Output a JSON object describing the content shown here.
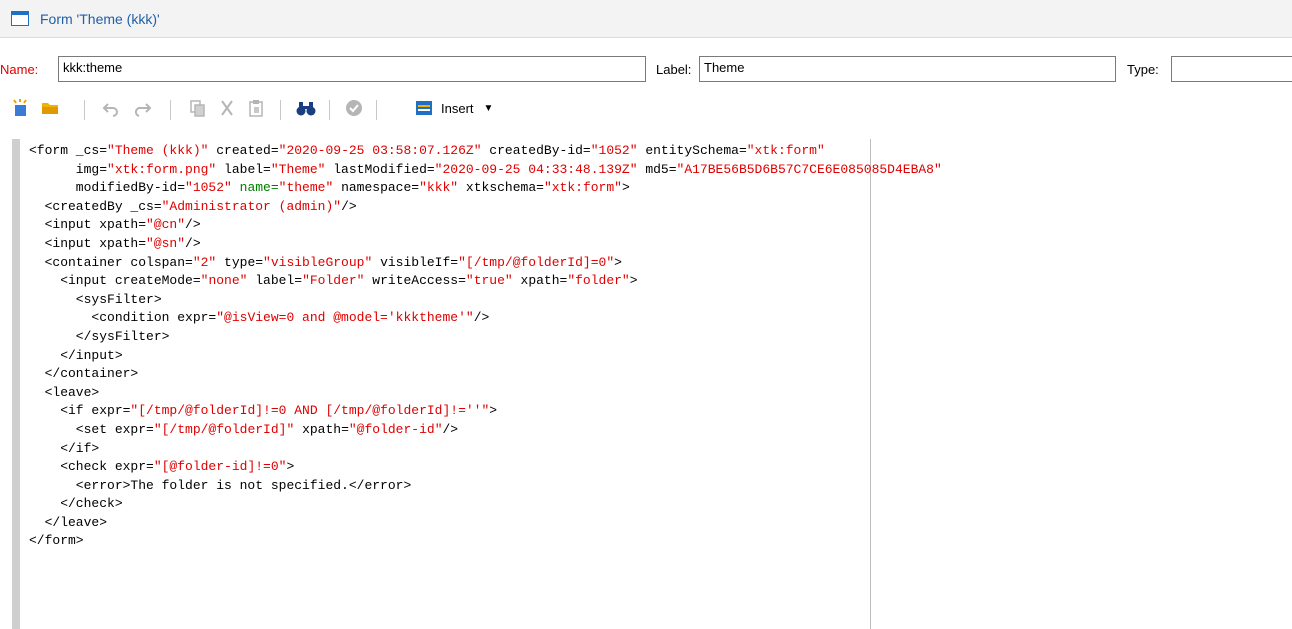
{
  "window": {
    "title": "Form 'Theme (kkk)'"
  },
  "fields": {
    "name_label": "Name:",
    "name_value": "kkk:theme",
    "label_label": "Label:",
    "label_value": "Theme",
    "type_label": "Type:",
    "type_value": ""
  },
  "toolbar": {
    "insert_label": "Insert",
    "icons": [
      "new-icon",
      "open-folder-icon",
      "undo-icon",
      "redo-icon",
      "copy-icon",
      "cut-icon",
      "paste-icon",
      "find-icon",
      "check-icon",
      "insert-icon",
      "chevron-down-icon"
    ]
  },
  "editor": {
    "lines": [
      [
        [
          "t",
          "<form _cs="
        ],
        [
          "v",
          "\"Theme (kkk)\""
        ],
        [
          "t",
          " created="
        ],
        [
          "v",
          "\"2020-09-25 03:58:07.126Z\""
        ],
        [
          "t",
          " createdBy-id="
        ],
        [
          "v",
          "\"1052\""
        ],
        [
          "t",
          " entitySchema="
        ],
        [
          "v",
          "\"xtk:form\""
        ]
      ],
      [
        [
          "t",
          "      img="
        ],
        [
          "v",
          "\"xtk:form.png\""
        ],
        [
          "t",
          " label="
        ],
        [
          "v",
          "\"Theme\""
        ],
        [
          "t",
          " lastModified="
        ],
        [
          "v",
          "\"2020-09-25 04:33:48.139Z\""
        ],
        [
          "t",
          " md5="
        ],
        [
          "v",
          "\"A17BE56B5D6B57C7CE6E085085D4EBA8\""
        ]
      ],
      [
        [
          "t",
          "      modifiedBy-id="
        ],
        [
          "v",
          "\"1052\""
        ],
        [
          "g",
          " name="
        ],
        [
          "v",
          "\"theme\""
        ],
        [
          "t",
          " namespace="
        ],
        [
          "v",
          "\"kkk\""
        ],
        [
          "t",
          " xtkschema="
        ],
        [
          "v",
          "\"xtk:form\""
        ],
        [
          "t",
          ">"
        ]
      ],
      [
        [
          "t",
          "  <createdBy _cs="
        ],
        [
          "v",
          "\"Administrator (admin)\""
        ],
        [
          "t",
          "/>"
        ]
      ],
      [
        [
          "t",
          "  <input xpath="
        ],
        [
          "v",
          "\"@cn\""
        ],
        [
          "t",
          "/>"
        ]
      ],
      [
        [
          "t",
          "  <input xpath="
        ],
        [
          "v",
          "\"@sn\""
        ],
        [
          "t",
          "/>"
        ]
      ],
      [
        [
          "t",
          "  <container colspan="
        ],
        [
          "v",
          "\"2\""
        ],
        [
          "t",
          " type="
        ],
        [
          "v",
          "\"visibleGroup\""
        ],
        [
          "t",
          " visibleIf="
        ],
        [
          "v",
          "\"[/tmp/@folderId]=0\""
        ],
        [
          "t",
          ">"
        ]
      ],
      [
        [
          "t",
          "    <input createMode="
        ],
        [
          "v",
          "\"none\""
        ],
        [
          "t",
          " label="
        ],
        [
          "v",
          "\"Folder\""
        ],
        [
          "t",
          " writeAccess="
        ],
        [
          "v",
          "\"true\""
        ],
        [
          "t",
          " xpath="
        ],
        [
          "v",
          "\"folder\""
        ],
        [
          "t",
          ">"
        ]
      ],
      [
        [
          "t",
          "      <sysFilter>"
        ]
      ],
      [
        [
          "t",
          "        <condition expr="
        ],
        [
          "v",
          "\"@isView=0 and @model='kkktheme'\""
        ],
        [
          "t",
          "/>"
        ]
      ],
      [
        [
          "t",
          "      </sysFilter>"
        ]
      ],
      [
        [
          "t",
          "    </input>"
        ]
      ],
      [
        [
          "t",
          "  </container>"
        ]
      ],
      [
        [
          "t",
          "  <leave>"
        ]
      ],
      [
        [
          "t",
          "    <if expr="
        ],
        [
          "v",
          "\"[/tmp/@folderId]!=0 AND [/tmp/@folderId]!=''\""
        ],
        [
          "t",
          ">"
        ]
      ],
      [
        [
          "t",
          "      <set expr="
        ],
        [
          "v",
          "\"[/tmp/@folderId]\""
        ],
        [
          "t",
          " xpath="
        ],
        [
          "v",
          "\"@folder-id\""
        ],
        [
          "t",
          "/>"
        ]
      ],
      [
        [
          "t",
          "    </if>"
        ]
      ],
      [
        [
          "t",
          "    <check expr="
        ],
        [
          "v",
          "\"[@folder-id]!=0\""
        ],
        [
          "t",
          ">"
        ]
      ],
      [
        [
          "t",
          "      <error>The folder is not specified.</error>"
        ]
      ],
      [
        [
          "t",
          "    </check>"
        ]
      ],
      [
        [
          "t",
          "  </leave>"
        ]
      ],
      [
        [
          "t",
          "</form>"
        ]
      ]
    ]
  },
  "colors": {
    "title_blue": "#1f5fa8",
    "required_red": "#e00000",
    "xml_value_red": "#e00000",
    "xml_attr_green": "#008000"
  }
}
